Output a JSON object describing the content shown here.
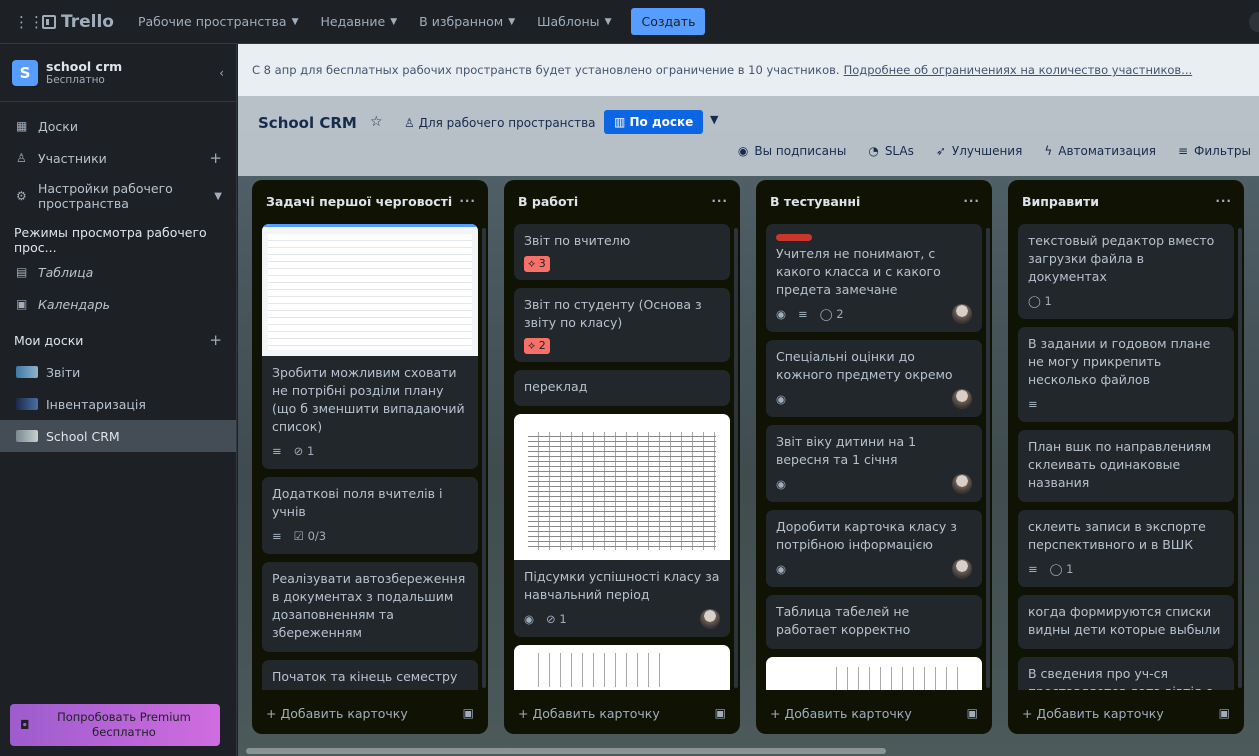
{
  "topnav": {
    "app_name": "Trello",
    "menus": [
      "Рабочие пространства",
      "Недавние",
      "В избранном",
      "Шаблоны"
    ],
    "create_label": "Создать"
  },
  "sidebar": {
    "workspace_initial": "S",
    "workspace_name": "school crm",
    "workspace_plan": "Бесплатно",
    "boards_label": "Доски",
    "members_label": "Участники",
    "settings_label": "Настройки рабочего пространства",
    "views_section": "Режимы просмотра рабочего прос...",
    "view_table": "Таблица",
    "view_calendar": "Календарь",
    "my_boards": "Мои доски",
    "boards": [
      "Звіти",
      "Інвентаризація",
      "School CRM"
    ],
    "premium_label": "Попробовать Premium бесплатно"
  },
  "banner": {
    "text": "С 8 апр для бесплатных рабочих пространств будет установлено ограничение в 10 участников.",
    "link": "Подробнее об ограничениях на количество участников..."
  },
  "board": {
    "title": "School CRM",
    "visibility": "Для рабочего пространства",
    "view": "По доске",
    "tools": [
      "Вы подписаны",
      "SLAs",
      "Улучшения",
      "Автоматизация",
      "Фильтры"
    ]
  },
  "add_card_label": "+ Добавить карточку",
  "lists": [
    {
      "title": "Задачі першої черговості",
      "cards": [
        {
          "text": "Зробити можливим сховати не потрібні розділи плану (що б зменшити випадаючий список)",
          "attach": "1"
        },
        {
          "text": "Додаткові поля вчителів і учнів",
          "check": "0/3"
        },
        {
          "text": "Реалізувати автозбереження в документах з подальшим дозаповненням та збереженням"
        },
        {
          "text": "Початок та кінець семестру в налаштуваннях школи на кожний рік"
        }
      ]
    },
    {
      "title": "В работі",
      "cards": [
        {
          "text": "Звіт по вчителю",
          "label": "3"
        },
        {
          "text": "Звіт по студенту (Основа з звіту по класу)",
          "label": "2"
        },
        {
          "text": "переклад"
        },
        {
          "text": "Підсумки успішності класу за навчальний період",
          "attach": "1"
        }
      ]
    },
    {
      "title": "В тестуванні",
      "cards": [
        {
          "text": "Учителя не понимают, с какого класса и с какого предета замечане",
          "comments": "2"
        },
        {
          "text": "Спеціальні оцінки до кожного предмету окремо"
        },
        {
          "text": "Звіт віку дитини на 1 вересня та 1 січня"
        },
        {
          "text": "Доробити карточка класу з потрібною інформацією"
        },
        {
          "text": "Таблица табелей не работает корректно"
        }
      ]
    },
    {
      "title": "Виправити",
      "cards": [
        {
          "text": "текстовый редактор вместо загрузки файла в документах",
          "comments": "1"
        },
        {
          "text": "В задании и годовом плане не могу прикрепить несколько файлов"
        },
        {
          "text": "План вшк по направлениям склеивать одинаковые названия"
        },
        {
          "text": "склеить записи в экспорте перспективного и в ВШК",
          "comments": "1"
        },
        {
          "text": "когда формируются списки видны дети которые выбыли"
        },
        {
          "text": "В сведения про уч-ся проставляется дата вівтія с прошлого года. Новій уч. год начался 1.09, а дата вівтія стоит май"
        }
      ]
    }
  ],
  "colors": {
    "accent": "#579dff",
    "list_bg": "#101204",
    "card_bg": "#22272b",
    "label_red": "#f87168"
  }
}
